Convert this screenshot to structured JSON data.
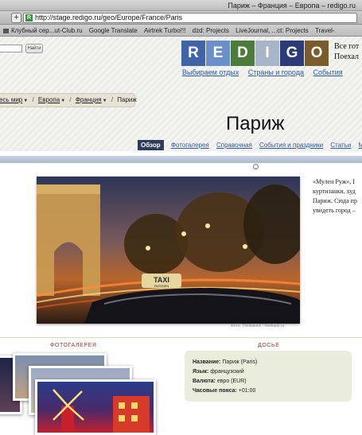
{
  "browser": {
    "window_title": "Париж – Франция – Европа – redigo.ru",
    "add_tab": "+",
    "url": "http://stage.redigo.ru/geo/Europe/France/Paris",
    "favicon_letter": "R",
    "bookmarks": [
      "Клубный сер...ut-Club.ru",
      "Google Translate",
      "Airtrek Turbo!!!",
      "dzd: Projects",
      "LiveJournal, ...ct: Projects",
      "Travel-"
    ]
  },
  "header": {
    "search_button": "Найти",
    "logo_letters": [
      "R",
      "E",
      "D",
      "I",
      "G",
      "O"
    ],
    "logo_colors": [
      "#3f64a8",
      "#6b8fc9",
      "#4c7c3a",
      "#a8b4c8",
      "#2a3b78",
      "#7a5c2c"
    ],
    "tagline_lines": [
      "Все гот",
      "Поехал"
    ],
    "nav": [
      "Выбираем отдых",
      "Страны и города",
      "События"
    ]
  },
  "breadcrumb": {
    "items": [
      "есь мир",
      "Европа",
      "Франция"
    ],
    "current": "Париж",
    "separator": "/",
    "arrow": "▼"
  },
  "page": {
    "title": "Париж",
    "tabs": [
      "Обзор",
      "Фотогалерея",
      "Справочная",
      "События и праздники",
      "Статьи",
      "Ме"
    ],
    "active_tab": 0
  },
  "photo": {
    "caption": "Фото: Thinkstock / fotobank.ru",
    "taxi_sign": "TAXI",
    "taxi_sub": "PARISIEN"
  },
  "intro": {
    "lines": [
      "«Мулен Руж», I",
      "куртизанки, худ",
      "Париж. Сюда пр",
      "увидеть город –"
    ]
  },
  "gallery": {
    "label": "ФОТОГАЛЕРЕЯ"
  },
  "dossier": {
    "label": "ДОСЬЕ",
    "rows": [
      {
        "key": "Название:",
        "value": "Париж (Paris)"
      },
      {
        "key": "Язык:",
        "value": "французский"
      },
      {
        "key": "Валюта:",
        "value": "евро (EUR)"
      },
      {
        "key": "Часовые пояса:",
        "value": "+01:00"
      }
    ]
  },
  "colors": {
    "accent_link": "#2d5aa6",
    "active_tab_bg": "#2f3b5c",
    "section_label": "#a0392f",
    "dossier_bg": "#ebeddc"
  }
}
